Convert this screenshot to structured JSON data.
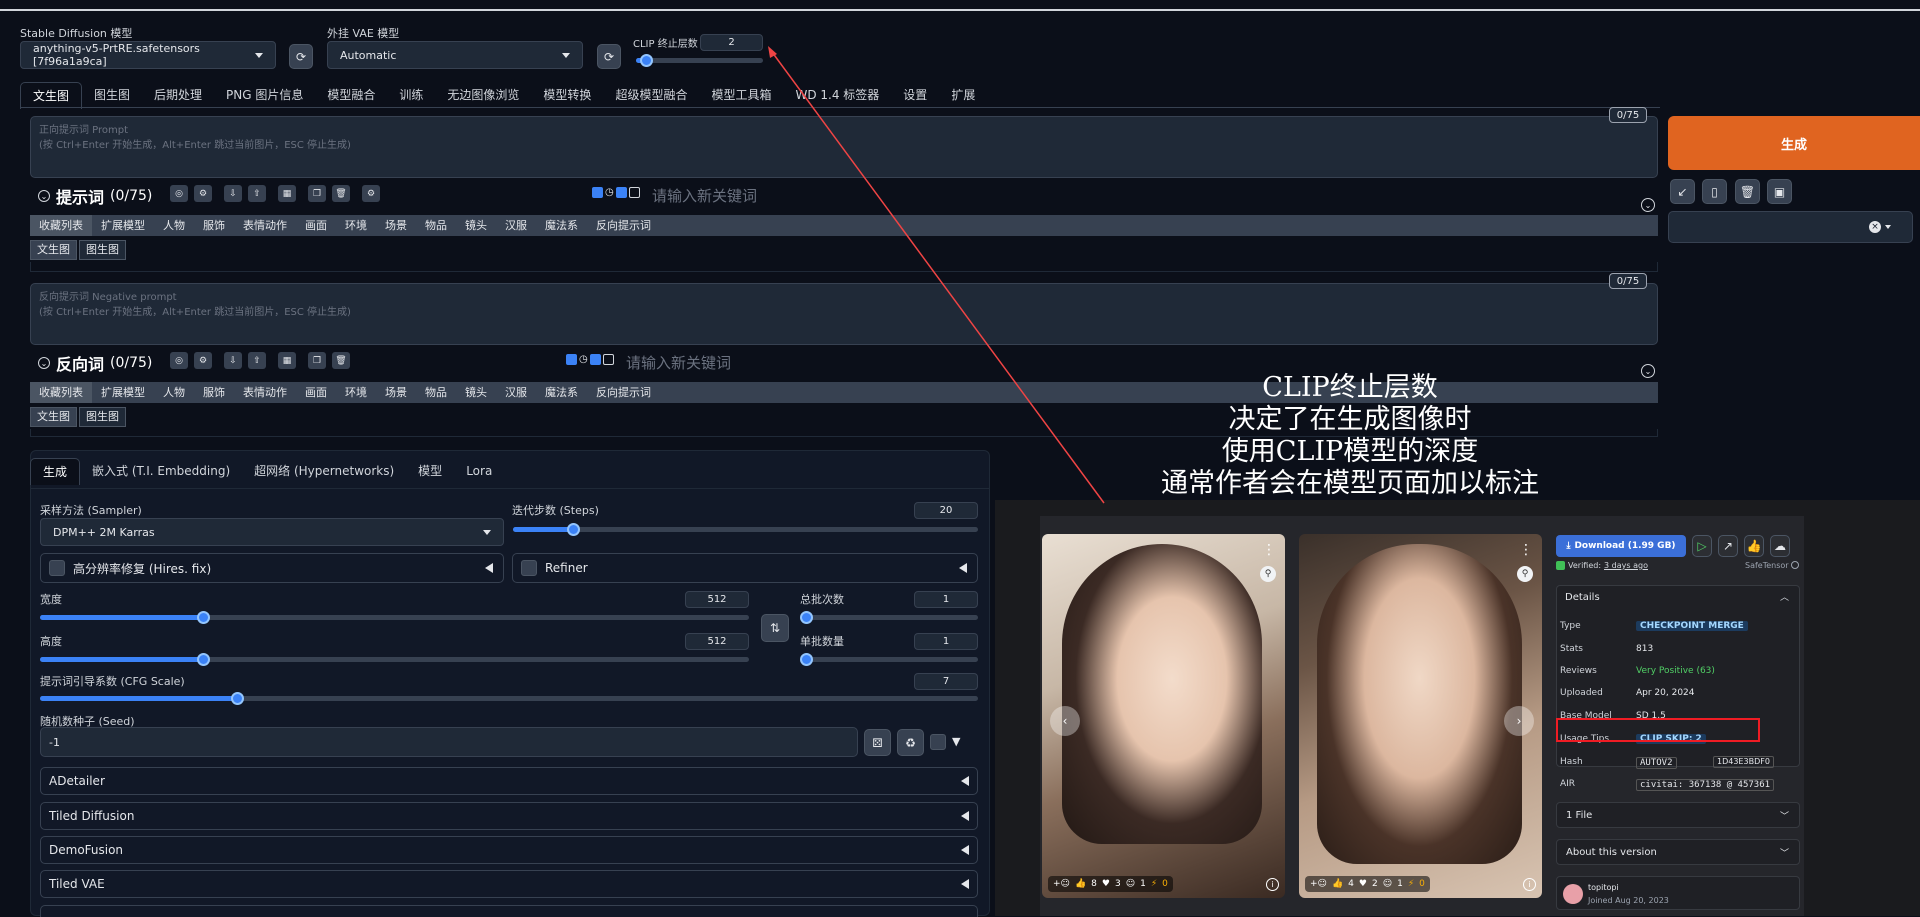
{
  "top": {
    "sd_model_label": "Stable Diffusion 模型",
    "sd_model_value": "anything-v5-PrtRE.safetensors [7f96a1a9ca]",
    "vae_label": "外挂 VAE 模型",
    "vae_value": "Automatic",
    "clip_label": "CLIP 终止层数",
    "clip_value": "2",
    "clip_fraction": 0.08
  },
  "main_tabs": [
    "文生图",
    "图生图",
    "后期处理",
    "PNG 图片信息",
    "模型融合",
    "训练",
    "无边图像浏览",
    "模型转换",
    "超级模型融合",
    "模型工具箱",
    "WD 1.4 标签器",
    "设置",
    "扩展"
  ],
  "prompt": {
    "placeholder_1": "正向提示词 Prompt",
    "placeholder_2": "(按 Ctrl+Enter 开始生成，Alt+Enter 跳过当前图片，ESC 停止生成)",
    "counter": "0/75"
  },
  "generate_label": "生成",
  "prompt_section": {
    "title": "提示词",
    "count": "(0/75)",
    "keyword_placeholder": "请输入新关键词"
  },
  "chips": [
    "收藏列表",
    "扩展模型",
    "人物",
    "服饰",
    "表情动作",
    "画面",
    "环境",
    "场景",
    "物品",
    "镜头",
    "汉服",
    "魔法系",
    "反向提示词"
  ],
  "subchips": [
    "文生图",
    "图生图"
  ],
  "negative": {
    "placeholder_1": "反向提示词 Negative prompt",
    "placeholder_2": "(按 Ctrl+Enter 开始生成，Alt+Enter 跳过当前图片，ESC 停止生成)",
    "counter": "0/75"
  },
  "negative_section": {
    "title": "反向词",
    "count": "(0/75)",
    "keyword_placeholder": "请输入新关键词"
  },
  "gen_tabs": [
    "生成",
    "嵌入式 (T.I. Embedding)",
    "超网络 (Hypernetworks)",
    "模型",
    "Lora"
  ],
  "params": {
    "sampler_label": "采样方法 (Sampler)",
    "sampler_value": "DPM++ 2M Karras",
    "steps_label": "迭代步数 (Steps)",
    "steps_value": "20",
    "steps_fraction": 0.13,
    "hires_label": "高分辨率修复 (Hires. fix)",
    "refiner_label": "Refiner",
    "width_label": "宽度",
    "width_value": "512",
    "width_fraction": 0.23,
    "height_label": "高度",
    "height_value": "512",
    "height_fraction": 0.23,
    "batch_count_label": "总批次数",
    "batch_count_value": "1",
    "batch_count_fraction": 0.0,
    "batch_size_label": "单批数量",
    "batch_size_value": "1",
    "batch_size_fraction": 0.0,
    "cfg_label": "提示词引导系数 (CFG Scale)",
    "cfg_value": "7",
    "cfg_fraction": 0.21,
    "seed_label": "随机数种子 (Seed)",
    "seed_value": "-1"
  },
  "accordions": [
    "ADetailer",
    "Tiled Diffusion",
    "DemoFusion",
    "Tiled VAE"
  ],
  "annotation": {
    "line1": "CLIP终止层数",
    "line2": "决定了在生成图像时",
    "line3": "使用CLIP模型的深度",
    "line4": "通常作者会在模型页面加以标注"
  },
  "civitai": {
    "download_label": "Download (1.99 GB)",
    "verified_label": "Verified:",
    "verified_date": "3 days ago",
    "format": "SafeTensor",
    "details_label": "Details",
    "rows": [
      {
        "key": "Type",
        "value": "CHECKPOINT MERGE"
      },
      {
        "key": "Stats",
        "value": "813"
      },
      {
        "key": "Reviews",
        "value": "Very Positive (63)"
      },
      {
        "key": "Uploaded",
        "value": "Apr 20, 2024"
      },
      {
        "key": "Base Model",
        "value": "SD 1.5"
      },
      {
        "key": "Usage Tips",
        "value": "CLIP SKIP: 2"
      },
      {
        "key": "Hash",
        "value": "AUTOV2"
      },
      {
        "key": "AIR",
        "value": "civitai: 367138 @ 457361"
      }
    ],
    "hash_value": "1D43E3BDF0",
    "files_label": "1 File",
    "about_label": "About this version",
    "author_name": "topitopi",
    "author_joined": "Joined Aug 20, 2023",
    "img1_stats": {
      "likes": "8",
      "hearts": "3",
      "comments": "1",
      "buzz": "0"
    },
    "img2_stats": {
      "likes": "4",
      "hearts": "2",
      "comments": "1",
      "buzz": "0"
    }
  },
  "colors": {
    "accent": "#3b82f6",
    "generate": "#ea580c",
    "highlight_box": "#ef4444",
    "arrow": "#ef4444"
  }
}
